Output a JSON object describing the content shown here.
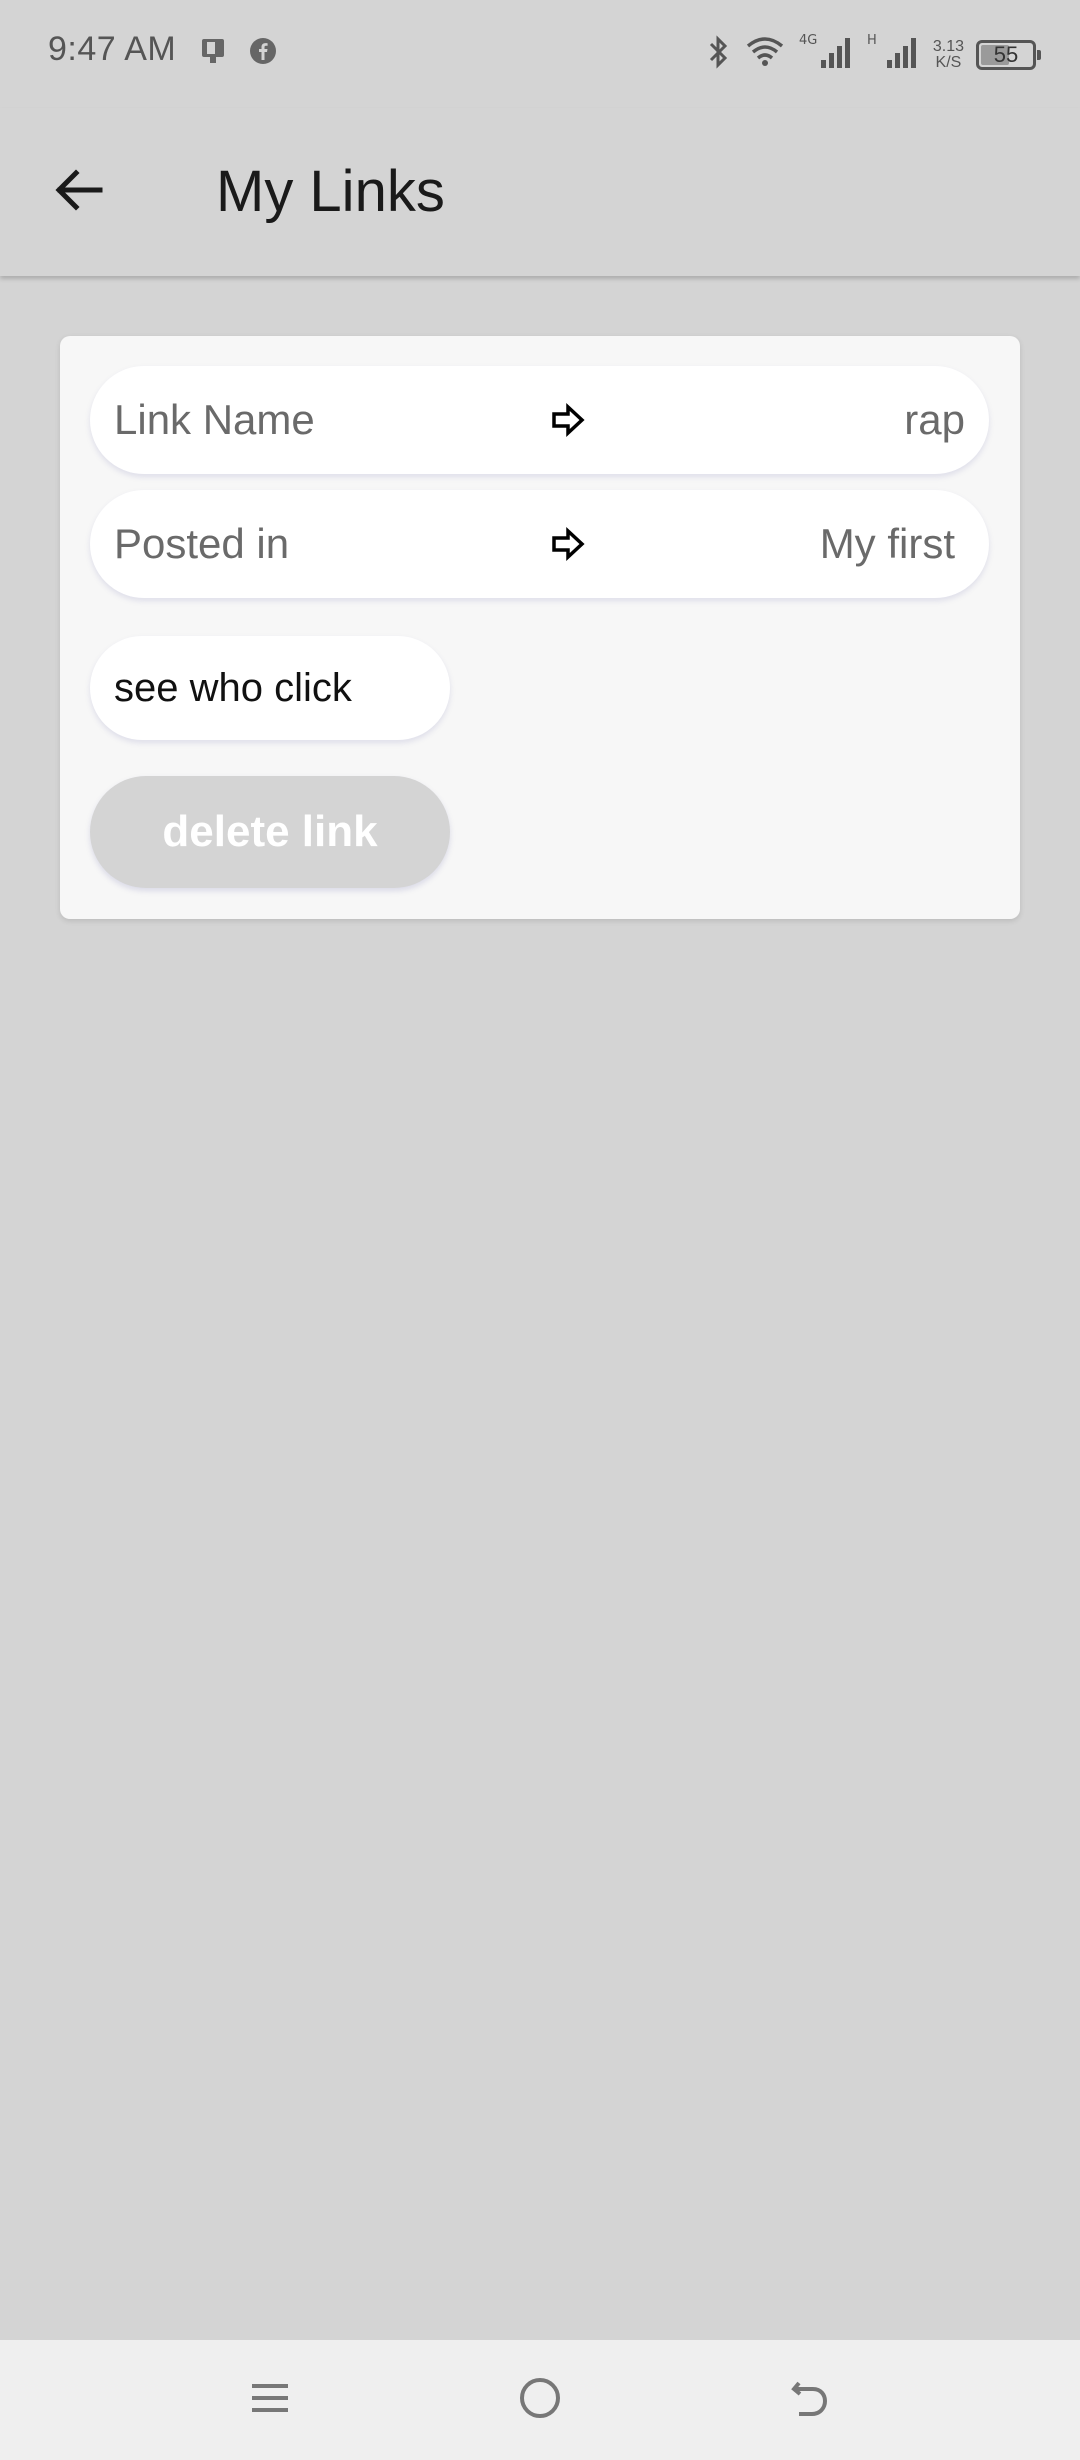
{
  "status_bar": {
    "time": "9:47 AM",
    "left_icons": [
      "sim-card-icon",
      "facebook-icon"
    ],
    "right_icons": [
      "bluetooth-icon",
      "wifi-icon",
      "signal-4g-icon",
      "signal-h-icon"
    ],
    "net_speed_value": "3.13",
    "net_speed_unit": "K/S",
    "battery_level": "55"
  },
  "app_bar": {
    "title": "My Links",
    "back_icon": "back-arrow-icon"
  },
  "link_card": {
    "rows": [
      {
        "label": "Link Name",
        "value": "rap",
        "icon": "arrow-right-outline-icon"
      },
      {
        "label": "Posted in",
        "value": "My first",
        "icon": "arrow-right-outline-icon"
      }
    ],
    "see_who_click_label": "see who click",
    "delete_label": "delete link"
  },
  "nav_bar": {
    "icons": [
      "menu-icon",
      "home-icon",
      "back-icon"
    ]
  },
  "colors": {
    "background": "#d4d4d4",
    "card": "#f7f7f7",
    "pill": "#ffffff",
    "delete_button": "#d4d4d4",
    "nav_bar": "#efefef"
  }
}
